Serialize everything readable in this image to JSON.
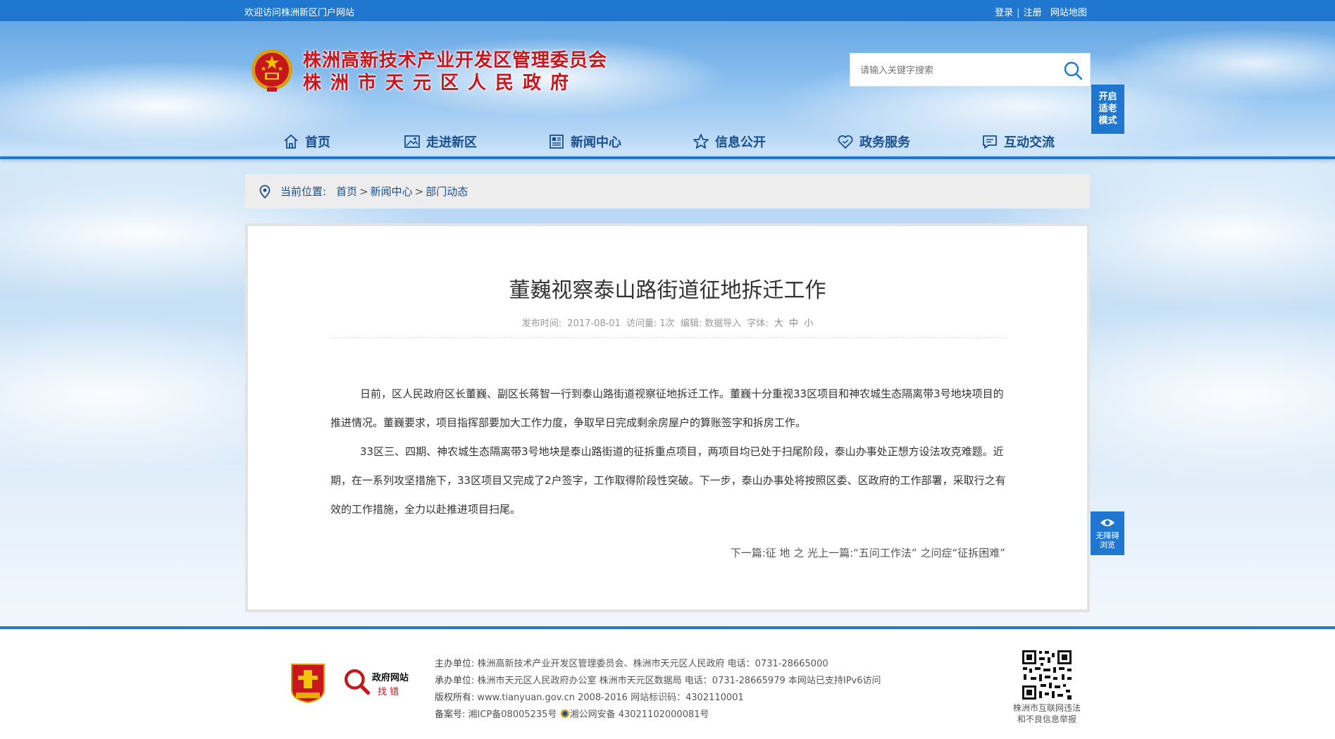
{
  "topbar": {
    "welcome": "欢迎访问株洲新区门户网站",
    "login": "登录",
    "register": "注册",
    "sitemap": "网站地图",
    "separator": "|"
  },
  "header": {
    "title_line1": "株洲高新技术产业开发区管理委员会",
    "title_line2": "株洲市天元区人民政府",
    "search_placeholder": "请输入关键字搜索",
    "elder_mode": [
      "开启",
      "适老",
      "模式"
    ]
  },
  "nav": [
    {
      "label": "首页",
      "icon": "home-icon"
    },
    {
      "label": "走进新区",
      "icon": "image-icon"
    },
    {
      "label": "新闻中心",
      "icon": "newspaper-icon"
    },
    {
      "label": "信息公开",
      "icon": "star-icon"
    },
    {
      "label": "政务服务",
      "icon": "heart-icon"
    },
    {
      "label": "互动交流",
      "icon": "chat-icon"
    }
  ],
  "breadcrumb": {
    "label": "当前位置:",
    "items": [
      "首页",
      "新闻中心",
      "部门动态"
    ],
    "separator": ">"
  },
  "article": {
    "title": "董巍视察泰山路街道征地拆迁工作",
    "meta": {
      "publish_label": "发布时间:",
      "publish_date": "2017-08-01",
      "views_label": "访问量:",
      "views": "1次",
      "editor_label": "编辑:",
      "editor": "数据导入",
      "font_label": "字体:",
      "font_large": "大",
      "font_medium": "中",
      "font_small": "小"
    },
    "paragraphs": [
      "日前，区人民政府区长董巍、副区长蒋智一行到泰山路街道视察征地拆迁工作。董巍十分重视33区项目和神农城生态隔离带3号地块项目的推进情况。董巍要求，项目指挥部要加大工作力度，争取早日完成剩余房屋户的算账签字和拆房工作。",
      "33区三、四期、神农城生态隔离带3号地块是泰山路街道的征拆重点项目，两项目均已处于扫尾阶段，泰山办事处正想方设法攻克难题。近期，在一系列攻坚措施下，33区项目又完成了2户签字，工作取得阶段性突破。下一步，泰山办事处将按照区委、区政府的工作部署，采取行之有效的工作措施，全力以赴推进项目扫尾。"
    ],
    "next_label": "下一篇:",
    "next_title": "征 地 之 光",
    "prev_label": "上一篇:",
    "prev_title": "“五问工作法” 之问症“征拆困难”"
  },
  "accessible": {
    "line1": "无障碍",
    "line2": "浏览"
  },
  "footer": {
    "badge2_top": "政府网站",
    "badge2_bottom": "找 错",
    "rows": [
      {
        "k": "主办单位:",
        "v": "株洲高新技术产业开发区管理委员会、株洲市天元区人民政府 电话：0731-28665000"
      },
      {
        "k": "承办单位:",
        "v": "株洲市天元区人民政府办公室 株洲市天元区数据局 电话：0731-28665979 本网站已支持IPv6访问"
      },
      {
        "k": "版权所有:",
        "v": "www.tianyuan.gov.cn 2008-2016 网站标识码：4302110001"
      },
      {
        "k": "备案号:",
        "v": "湘ICP备08005235号",
        "v2": "湘公网安备 43021102000081号"
      }
    ],
    "qr_caption_line1": "株洲市互联网违法",
    "qr_caption_line2": "和不良信息举报"
  },
  "colors": {
    "brand_blue": "#1f77d0",
    "title_red": "#c8161d",
    "nav_text": "#1a4f8e"
  }
}
